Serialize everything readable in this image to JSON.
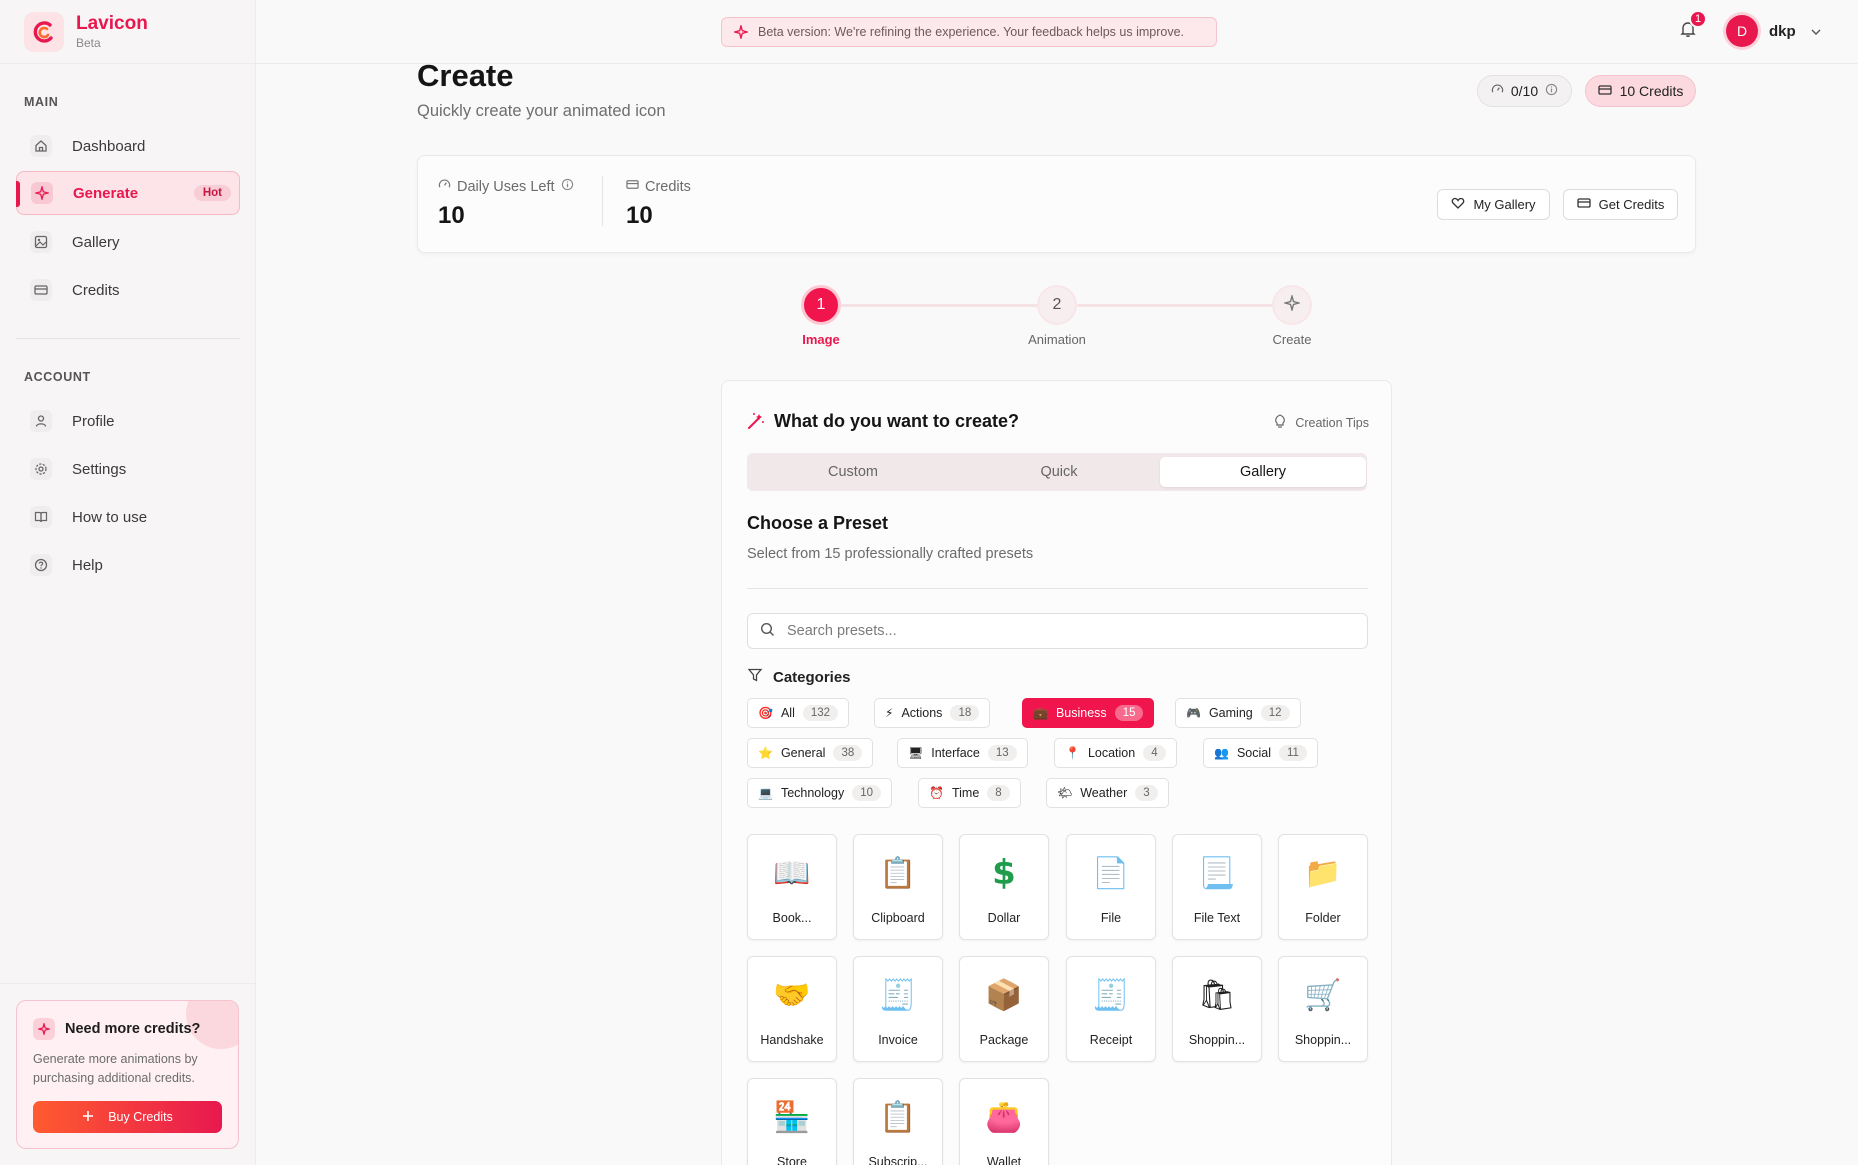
{
  "brand": {
    "name": "Lavicon",
    "tag": "Beta"
  },
  "sidebar": {
    "main_title": "MAIN",
    "main_items": [
      {
        "label": "Dashboard",
        "icon": "home-icon"
      },
      {
        "label": "Generate",
        "icon": "sparkle-icon",
        "badge": "Hot",
        "active": true
      },
      {
        "label": "Gallery",
        "icon": "image-icon"
      },
      {
        "label": "Credits",
        "icon": "credit-card-icon"
      }
    ],
    "account_title": "ACCOUNT",
    "account_items": [
      {
        "label": "Profile",
        "icon": "user-icon"
      },
      {
        "label": "Settings",
        "icon": "gear-icon"
      },
      {
        "label": "How to use",
        "icon": "book-icon"
      },
      {
        "label": "Help",
        "icon": "help-circle-icon"
      }
    ],
    "promo": {
      "title": "Need more credits?",
      "description": "Generate more animations by purchasing additional credits.",
      "button": "Buy Credits"
    }
  },
  "topbar": {
    "banner": "Beta version: We're refining the experience. Your feedback helps us improve.",
    "notification_count": "1",
    "avatar_initial": "D",
    "user_name": "dkp"
  },
  "page": {
    "title": "Create",
    "subtitle": "Quickly create your animated icon",
    "uses_pill": "0/10",
    "credits_pill": "10 Credits"
  },
  "stats": {
    "daily_label": "Daily Uses Left",
    "daily_value": "10",
    "credits_label": "Credits",
    "credits_value": "10",
    "my_gallery": "My Gallery",
    "get_credits": "Get Credits"
  },
  "stepper": [
    {
      "marker": "1",
      "label": "Image",
      "active": true
    },
    {
      "marker": "2",
      "label": "Animation",
      "active": false
    },
    {
      "marker": "",
      "label": "Create",
      "active": false
    }
  ],
  "creator": {
    "title": "What do you want to create?",
    "tips": "Creation Tips",
    "tabs": [
      "Custom",
      "Quick",
      "Gallery"
    ],
    "active_tab": "Gallery",
    "preset_title": "Choose a Preset",
    "preset_subtitle": "Select from 15 professionally crafted presets",
    "search_placeholder": "Search presets...",
    "categories_title": "Categories",
    "categories": [
      {
        "emoji": "🎯",
        "label": "All",
        "count": "132"
      },
      {
        "emoji": "⚡",
        "label": "Actions",
        "count": "18"
      },
      {
        "emoji": "💼",
        "label": "Business",
        "count": "15",
        "active": true
      },
      {
        "emoji": "🎮",
        "label": "Gaming",
        "count": "12"
      },
      {
        "emoji": "⭐",
        "label": "General",
        "count": "38"
      },
      {
        "emoji": "🖥",
        "label": "Interface",
        "count": "13"
      },
      {
        "emoji": "📍",
        "label": "Location",
        "count": "4"
      },
      {
        "emoji": "👥",
        "label": "Social",
        "count": "11"
      },
      {
        "emoji": "💻",
        "label": "Technology",
        "count": "10"
      },
      {
        "emoji": "⏰",
        "label": "Time",
        "count": "8"
      },
      {
        "emoji": "🌤",
        "label": "Weather",
        "count": "3"
      }
    ],
    "presets": [
      {
        "emoji": "📖",
        "label": "Book..."
      },
      {
        "emoji": "📋",
        "label": "Clipboard"
      },
      {
        "emoji": "$",
        "label": "Dollar"
      },
      {
        "emoji": "📄",
        "label": "File"
      },
      {
        "emoji": "📃",
        "label": "File Text"
      },
      {
        "emoji": "📁",
        "label": "Folder"
      },
      {
        "emoji": "🤝",
        "label": "Handshake"
      },
      {
        "emoji": "🧾",
        "label": "Invoice"
      },
      {
        "emoji": "📦",
        "label": "Package"
      },
      {
        "emoji": "🧾",
        "label": "Receipt"
      },
      {
        "emoji": "🛍",
        "label": "Shoppin..."
      },
      {
        "emoji": "🛒",
        "label": "Shoppin..."
      },
      {
        "emoji": "🏪",
        "label": "Store"
      },
      {
        "emoji": "📋",
        "label": "Subscrip..."
      },
      {
        "emoji": "👛",
        "label": "Wallet"
      }
    ]
  },
  "colors": {
    "accent": "#e8184f",
    "accent_light": "#fde4e8",
    "orange": "#ff5b2f"
  }
}
